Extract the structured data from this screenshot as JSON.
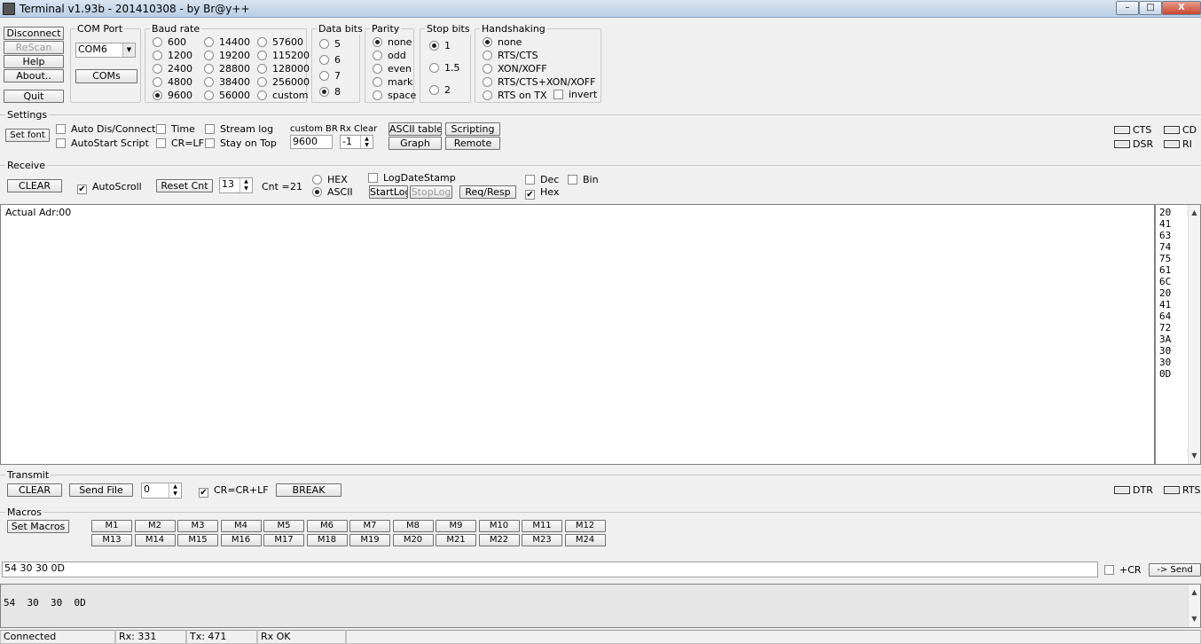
{
  "window": {
    "title": "Terminal v1.93b - 201410308 - by Br@y++",
    "minimize": "–",
    "maximize": "□",
    "close": "X"
  },
  "left": {
    "disconnect": "Disconnect",
    "rescan": "ReScan",
    "help": "Help",
    "about": "About..",
    "quit": "Quit"
  },
  "comport": {
    "title": "COM Port",
    "value": "COM6",
    "coms": "COMs"
  },
  "baud": {
    "title": "Baud rate",
    "options": [
      "600",
      "1200",
      "2400",
      "4800",
      "9600",
      "14400",
      "19200",
      "28800",
      "38400",
      "56000",
      "57600",
      "115200",
      "128000",
      "256000",
      "custom"
    ],
    "selected": "9600"
  },
  "databits": {
    "title": "Data bits",
    "options": [
      "5",
      "6",
      "7",
      "8"
    ],
    "selected": "8"
  },
  "parity": {
    "title": "Parity",
    "options": [
      "none",
      "odd",
      "even",
      "mark",
      "space"
    ],
    "selected": "none"
  },
  "stopbits": {
    "title": "Stop bits",
    "options": [
      "1",
      "1.5",
      "2"
    ],
    "selected": "1"
  },
  "handshaking": {
    "title": "Handshaking",
    "options": [
      "none",
      "RTS/CTS",
      "XON/XOFF",
      "RTS/CTS+XON/XOFF",
      "RTS on TX"
    ],
    "selected": "none",
    "invert": "invert"
  },
  "settings": {
    "title": "Settings",
    "setfont": "Set font",
    "auto_dis": "Auto Dis/Connect",
    "autostart": "AutoStart Script",
    "time": "Time",
    "crlf": "CR=LF",
    "streamlog": "Stream log",
    "stayontop": "Stay on Top",
    "custom_br_label": "custom BR",
    "custom_br_value": "9600",
    "rxclear_label": "Rx Clear",
    "rxclear_value": "-1",
    "ascii_table": "ASCII table",
    "scripting": "Scripting",
    "graph": "Graph",
    "remote": "Remote"
  },
  "leds": {
    "cts": "CTS",
    "cd": "CD",
    "dsr": "DSR",
    "ri": "RI",
    "dtr": "DTR",
    "rts": "RTS"
  },
  "receive": {
    "title": "Receive",
    "clear": "CLEAR",
    "autoscroll": "AutoScroll",
    "resetcnt": "Reset Cnt",
    "cnt_spin": "13",
    "cnt_label": "Cnt =",
    "cnt_value": "21",
    "hex": "HEX",
    "ascii": "ASCII",
    "mode_selected": "ASCII",
    "logdatestamp": "LogDateStamp",
    "startlog": "StartLog",
    "stoplog": "StopLog",
    "reqresp": "Req/Resp",
    "dec": "Dec",
    "bin": "Bin",
    "hexchk": "Hex"
  },
  "rx_text": "Actual Adr:00",
  "hex_values": [
    "20",
    "41",
    "63",
    "74",
    "75",
    "61",
    "6C",
    "20",
    "41",
    "64",
    "72",
    "3A",
    "30",
    "30",
    "0D"
  ],
  "transmit": {
    "title": "Transmit",
    "clear": "CLEAR",
    "sendfile": "Send File",
    "spin": "0",
    "crcrlf": "CR=CR+LF",
    "break": "BREAK"
  },
  "macros": {
    "title": "Macros",
    "set": "Set Macros",
    "row1": [
      "M1",
      "M2",
      "M3",
      "M4",
      "M5",
      "M6",
      "M7",
      "M8",
      "M9",
      "M10",
      "M11",
      "M12"
    ],
    "row2": [
      "M13",
      "M14",
      "M15",
      "M16",
      "M17",
      "M18",
      "M19",
      "M20",
      "M21",
      "M22",
      "M23",
      "M24"
    ]
  },
  "send": {
    "input": "54 30 30 0D",
    "cr": "+CR",
    "send": "-> Send"
  },
  "tx_history": "54  30  30  0D",
  "status": {
    "conn": "Connected",
    "rx": "Rx: 331",
    "tx": "Tx: 471",
    "rxok": "Rx OK"
  }
}
